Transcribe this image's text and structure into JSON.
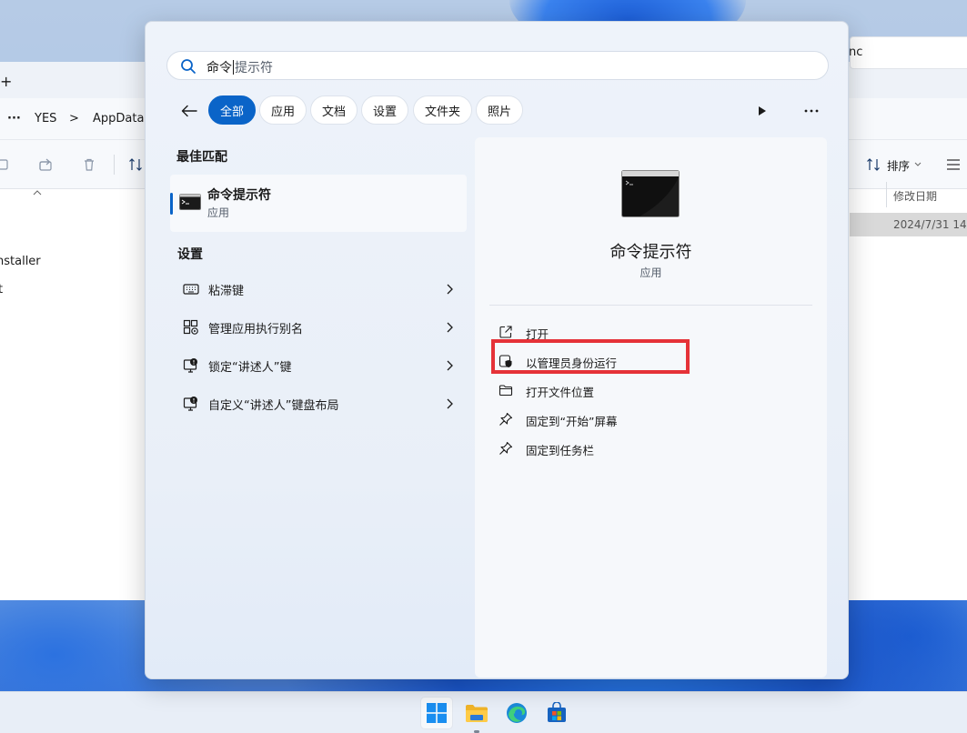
{
  "search": {
    "query_typed": "命令",
    "query_rest": "提示符"
  },
  "filters": [
    {
      "label": "全部",
      "active": true
    },
    {
      "label": "应用",
      "active": false
    },
    {
      "label": "文档",
      "active": false
    },
    {
      "label": "设置",
      "active": false
    },
    {
      "label": "文件夹",
      "active": false
    },
    {
      "label": "照片",
      "active": false
    }
  ],
  "best_match": {
    "section_title": "最佳匹配",
    "name": "命令提示符",
    "type": "应用"
  },
  "settings": {
    "section_title": "设置",
    "items": [
      {
        "label": "粘滞键",
        "icon": "keyboard-icon"
      },
      {
        "label": "管理应用执行别名",
        "icon": "app-alias-icon"
      },
      {
        "label": "锁定“讲述人”键",
        "icon": "narrator-icon"
      },
      {
        "label": "自定义“讲述人”键盘布局",
        "icon": "narrator-icon"
      }
    ]
  },
  "preview": {
    "name": "命令提示符",
    "type": "应用",
    "actions": [
      {
        "label": "打开",
        "icon": "open-external-icon"
      },
      {
        "label": "以管理员身份运行",
        "icon": "shield-admin-icon",
        "highlighted": true
      },
      {
        "label": "打开文件位置",
        "icon": "folder-icon"
      },
      {
        "label": "固定到“开始”屏幕",
        "icon": "pin-icon"
      },
      {
        "label": "固定到任务栏",
        "icon": "pin-icon"
      }
    ]
  },
  "explorer_background": {
    "breadcrumb_more": "···",
    "breadcrumb_1": "YES",
    "breadcrumb_sep": ">",
    "breadcrumb_2": "AppData",
    "address_right": "nc",
    "sort_label": "排序",
    "column_date": "修改日期",
    "row_date": "2024/7/31 14:",
    "list_item_1": "nstaller",
    "list_item_2": "t",
    "new_tab_plus": "+"
  },
  "colors": {
    "accent": "#0a64c8",
    "highlight_red": "#e53238"
  }
}
